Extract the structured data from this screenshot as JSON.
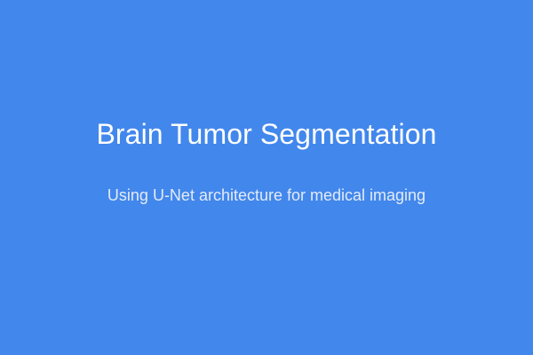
{
  "slide": {
    "title": "Brain Tumor Segmentation",
    "subtitle": "Using U-Net architecture for medical imaging"
  },
  "colors": {
    "background": "#4287ec",
    "title": "#ffffff",
    "subtitle": "#e3ebf8"
  }
}
